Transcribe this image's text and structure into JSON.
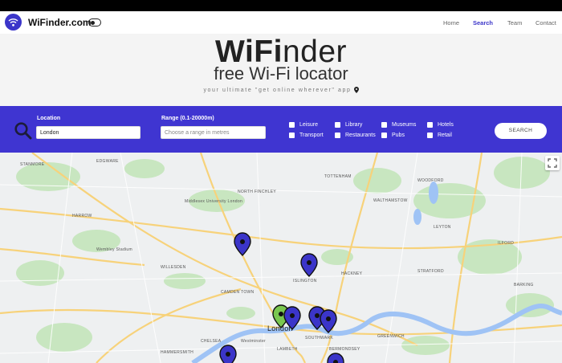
{
  "nav": {
    "brand": "WiFinder.com",
    "links": [
      "Home",
      "Search",
      "Team",
      "Contact"
    ],
    "active_link": "Search"
  },
  "hero": {
    "title_bold": "WiFi",
    "title_rest": "nder",
    "subtitle": "free Wi-Fi locator",
    "tagline": "your ultimate \"get online wherever\" app"
  },
  "search": {
    "location_label": "Location",
    "location_value": "London",
    "range_label": "Range (0.1-20000m)",
    "range_placeholder": "Choose a range in metres",
    "categories": [
      "Leisure",
      "Library",
      "Museums",
      "Hotels",
      "Transport",
      "Restaurants",
      "Pubs",
      "Retail"
    ],
    "button_label": "SEARCH"
  },
  "map": {
    "place_labels": [
      "EDGWARE",
      "STANMORE",
      "NORTH FINCHLEY",
      "Middlesex University London",
      "HARROW",
      "Wembley Stadium",
      "WILLESDEN",
      "ISLINGTON",
      "HACKNEY",
      "London",
      "WALTHAMSTOW",
      "WOODFORD",
      "TOTTENHAM",
      "ILFORD",
      "STRATFORD",
      "CAMDEN TOWN",
      "BARKING",
      "LEYTON",
      "BERMONDSEY",
      "LAMBETH",
      "HAMMERSMITH",
      "Westminster",
      "CHELSEA",
      "SOUTHWARK",
      "GREENWICH"
    ],
    "pin_colors": {
      "default": "#3b35c9",
      "selected": "#7ac74f"
    }
  },
  "colors": {
    "accent": "#3f35d1",
    "brand": "#3b35c9"
  }
}
